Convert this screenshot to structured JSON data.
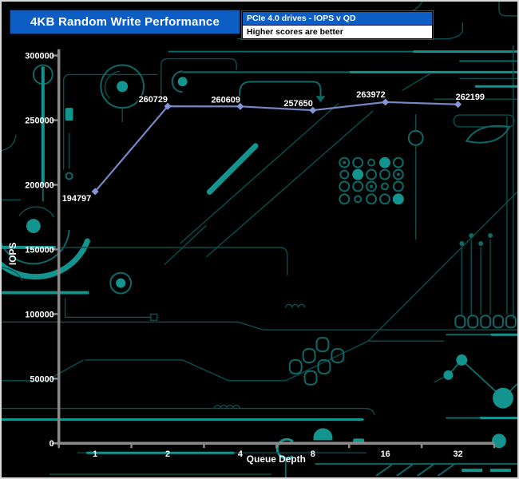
{
  "header": {
    "title": "4KB Random Write Performance",
    "subtitle_line1": "PCIe 4.0 drives - IOPS v QD",
    "subtitle_line2": "Higher scores are better"
  },
  "colors": {
    "header_blue": "#0d5ec4",
    "line": "#7688c4",
    "marker": "#8596d6",
    "axis_gray": "#8a8a8a",
    "label_white": "#ffffff",
    "circuit_dim": "#0a4f4f",
    "circuit_mid": "#0e6868",
    "circuit_bright": "#13948f",
    "background": "#000000"
  },
  "chart_data": {
    "type": "line",
    "title": "4KB Random Write Performance",
    "xlabel": "Queue Depth",
    "ylabel": "IOPS",
    "categories": [
      "1",
      "2",
      "4",
      "8",
      "16",
      "32"
    ],
    "series": [
      {
        "name": "PCIe 4.0 drive",
        "values": [
          194797,
          260729,
          260609,
          257650,
          263972,
          262199
        ]
      }
    ],
    "ylim": [
      0,
      300000
    ],
    "ytick_step": 50000,
    "grid": false,
    "legend_position": "none",
    "data_labels": true,
    "notes": "Higher scores are better"
  }
}
